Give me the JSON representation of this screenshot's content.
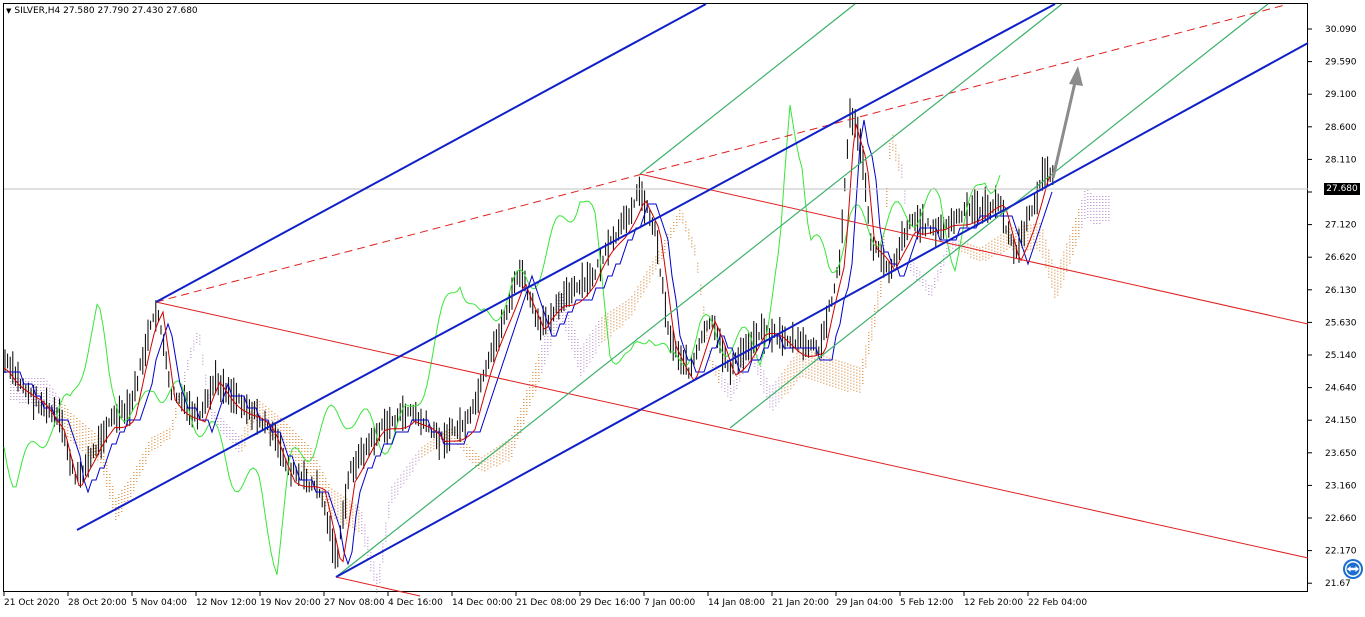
{
  "header": {
    "symbol": "SILVER,H4",
    "ohlc": "27.580 27.790 27.430 27.680"
  },
  "price_axis": {
    "labels": [
      "30.090",
      "29.590",
      "29.100",
      "28.600",
      "28.110",
      "27.610",
      "27.120",
      "26.620",
      "26.130",
      "25.630",
      "25.140",
      "24.640",
      "24.150",
      "23.650",
      "23.160",
      "22.660",
      "22.170",
      "21.67"
    ],
    "current_price": "27.680"
  },
  "time_axis": {
    "labels": [
      "21 Oct 2020",
      "28 Oct 20:00",
      "5 Nov 04:00",
      "12 Nov 12:00",
      "19 Nov 20:00",
      "27 Nov 08:00",
      "4 Dec 16:00",
      "14 Dec 00:00",
      "21 Dec 08:00",
      "29 Dec 16:00",
      "7 Jan 00:00",
      "14 Jan 08:00",
      "21 Jan 20:00",
      "29 Jan 04:00",
      "5 Feb 12:00",
      "12 Feb 20:00",
      "22 Feb 04:00"
    ]
  },
  "colors": {
    "blue_channel": "#1020c8",
    "green_channel": "#3cb06a",
    "red_lines": "#e02020",
    "chikou_span": "#39e639",
    "tenkan": "#d00000",
    "kijun": "#0000cc",
    "cloud_orange": "#e0a060",
    "cloud_violet": "#c8a8d8",
    "arrow_gray": "#8c8c8c"
  },
  "icons": {
    "menu": "triangle-down-icon",
    "teamviewer": "teamviewer-icon"
  }
}
